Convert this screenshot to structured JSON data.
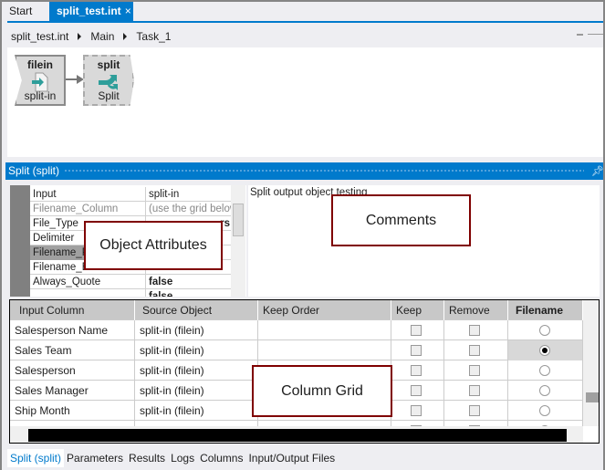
{
  "tabs": [
    {
      "label": "Start"
    },
    {
      "label": "split_test.int",
      "close": "×"
    }
  ],
  "breadcrumb": [
    "split_test.int",
    "Main",
    "Task_1"
  ],
  "canvas": {
    "nodes": [
      {
        "type": "filein",
        "name": "split-in",
        "icon": "file-arrow-icon"
      },
      {
        "type": "split",
        "name": "Split",
        "icon": "split-arrows-icon"
      }
    ]
  },
  "panel": {
    "title": "Split (split)"
  },
  "attributes": [
    {
      "name": "Input",
      "value": "split-in"
    },
    {
      "name": "Filename_Column",
      "value": "(use the grid below",
      "dim": true
    },
    {
      "name": "File_Type",
      "value": "rs"
    },
    {
      "name": "Delimiter",
      "value": ""
    },
    {
      "name": "Filename_P",
      "value": ""
    },
    {
      "name": "Filename_E",
      "value": ""
    },
    {
      "name": "Always_Quote",
      "value": "false"
    },
    {
      "name": "",
      "value": "false"
    }
  ],
  "comments": {
    "text": "Split output object testing"
  },
  "grid": {
    "headers": [
      "Input Column",
      "Source Object",
      "Keep Order",
      "Keep",
      "Remove",
      "Filename"
    ],
    "rows": [
      {
        "input": "Salesperson Name",
        "source": "split-in (filein)",
        "keep_order": "",
        "keep": false,
        "remove": false,
        "filename": false
      },
      {
        "input": "Sales Team",
        "source": "split-in (filein)",
        "keep_order": "",
        "keep": false,
        "remove": false,
        "filename": true
      },
      {
        "input": "Salesperson",
        "source": "split-in (filein)",
        "keep_order": "",
        "keep": false,
        "remove": false,
        "filename": false
      },
      {
        "input": "Sales Manager",
        "source": "split-in (filein)",
        "keep_order": "",
        "keep": false,
        "remove": false,
        "filename": false
      },
      {
        "input": "Ship Month",
        "source": "split-in (filein)",
        "keep_order": "",
        "keep": false,
        "remove": false,
        "filename": false
      }
    ]
  },
  "annotations": {
    "attributes": "Object Attributes",
    "comments": "Comments",
    "grid": "Column Grid"
  },
  "bottom_tabs": [
    "Split (split)",
    "Parameters",
    "Results",
    "Logs",
    "Columns",
    "Input/Output Files"
  ],
  "colors": {
    "accent": "#007acc",
    "annotation_border": "#7f0000"
  }
}
